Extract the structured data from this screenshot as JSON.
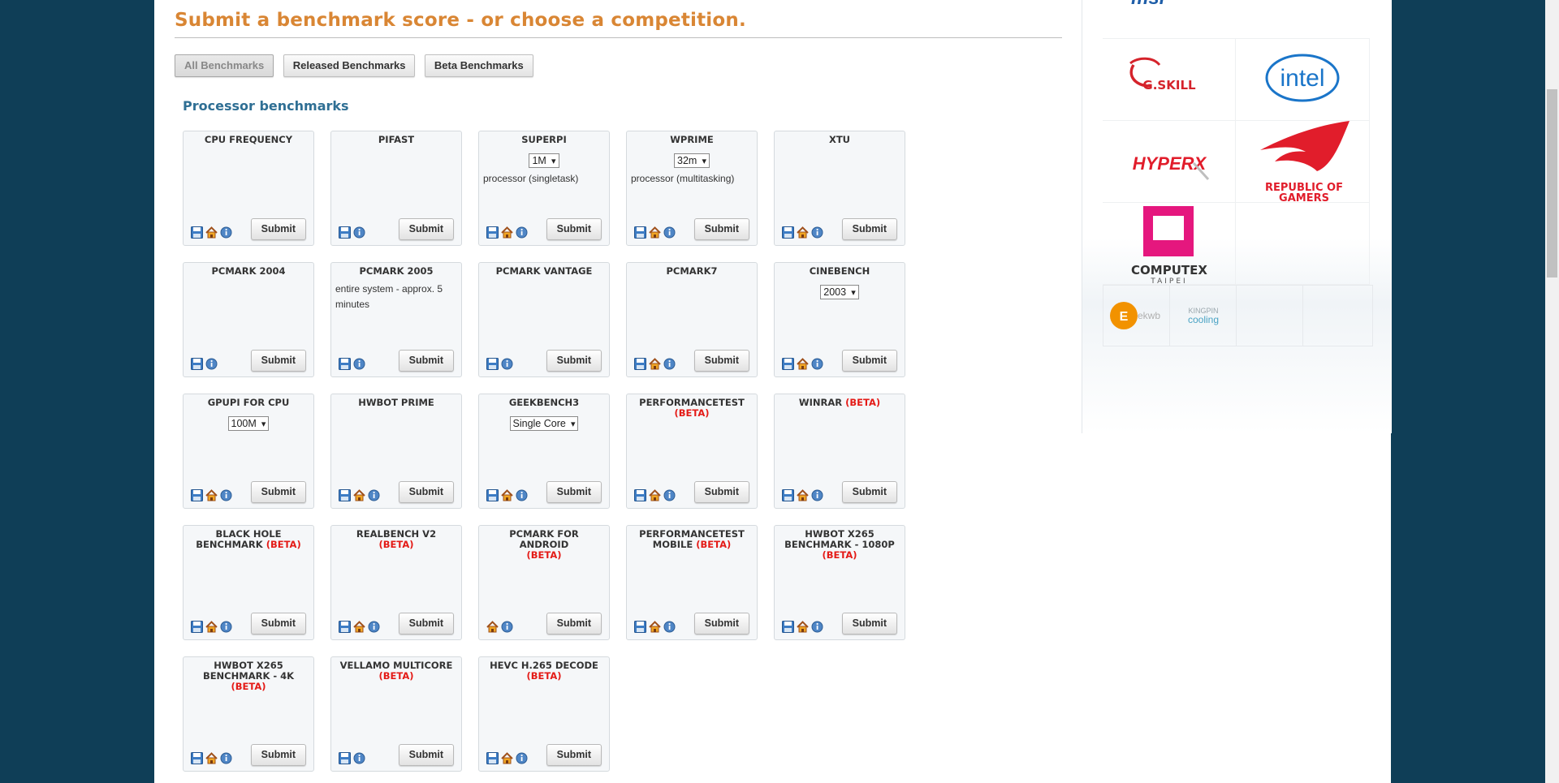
{
  "page": {
    "title": "Submit a benchmark score - or choose a competition."
  },
  "filters": [
    {
      "label": "All Benchmarks",
      "active": true
    },
    {
      "label": "Released Benchmarks",
      "active": false
    },
    {
      "label": "Beta Benchmarks",
      "active": false
    }
  ],
  "section": {
    "title": "Processor benchmarks"
  },
  "submit_label": "Submit",
  "beta_label": "(BETA)",
  "cards": [
    {
      "title": "CPU FREQUENCY",
      "icons": [
        "floppy-icon",
        "home-icon",
        "info-icon"
      ]
    },
    {
      "title": "PIFAST",
      "icons": [
        "floppy-icon",
        "info-icon"
      ]
    },
    {
      "title": "SUPERPI",
      "select": "1M",
      "desc": "processor (singletask)",
      "icons": [
        "floppy-icon",
        "home-icon",
        "info-icon"
      ]
    },
    {
      "title": "WPRIME",
      "select": "32m",
      "desc": "processor (multitasking)",
      "icons": [
        "floppy-icon",
        "home-icon",
        "info-icon"
      ]
    },
    {
      "title": "XTU",
      "icons": [
        "floppy-icon",
        "home-icon",
        "info-icon"
      ]
    },
    {
      "title": "PCMARK 2004",
      "icons": [
        "floppy-icon",
        "info-icon"
      ]
    },
    {
      "title": "PCMARK 2005",
      "desc": "entire system - approx. 5 minutes",
      "icons": [
        "floppy-icon",
        "info-icon"
      ]
    },
    {
      "title": "PCMARK VANTAGE",
      "icons": [
        "floppy-icon",
        "info-icon"
      ]
    },
    {
      "title": "PCMARK7",
      "icons": [
        "floppy-icon",
        "home-icon",
        "info-icon"
      ]
    },
    {
      "title": "CINEBENCH",
      "select": "2003",
      "icons": [
        "floppy-icon",
        "home-icon",
        "info-icon"
      ]
    },
    {
      "title": "GPUPI FOR CPU",
      "select": "100M",
      "icons": [
        "floppy-icon",
        "home-icon",
        "info-icon"
      ]
    },
    {
      "title": "HWBOT PRIME",
      "icons": [
        "floppy-icon",
        "home-icon",
        "info-icon"
      ]
    },
    {
      "title": "GEEKBENCH3",
      "select": "Single Core",
      "icons": [
        "floppy-icon",
        "home-icon",
        "info-icon"
      ]
    },
    {
      "title": "PERFORMANCETEST",
      "beta": true,
      "icons": [
        "floppy-icon",
        "home-icon",
        "info-icon"
      ]
    },
    {
      "title": "WINRAR",
      "beta": true,
      "inline_beta": true,
      "icons": [
        "floppy-icon",
        "home-icon",
        "info-icon"
      ]
    },
    {
      "title": "BLACK HOLE BENCHMARK",
      "beta": true,
      "inline_beta": true,
      "icons": [
        "floppy-icon",
        "home-icon",
        "info-icon"
      ]
    },
    {
      "title": "REALBENCH V2",
      "beta": true,
      "inline_beta": true,
      "icons": [
        "floppy-icon",
        "home-icon",
        "info-icon"
      ]
    },
    {
      "title": "PCMARK FOR ANDROID",
      "beta": true,
      "icons": [
        "home-icon",
        "info-icon"
      ]
    },
    {
      "title": "PERFORMANCETEST MOBILE",
      "beta": true,
      "inline_beta": true,
      "icons": [
        "floppy-icon",
        "home-icon",
        "info-icon"
      ]
    },
    {
      "title": "HWBOT X265 BENCHMARK - 1080P",
      "beta": true,
      "icons": [
        "floppy-icon",
        "home-icon",
        "info-icon"
      ]
    },
    {
      "title": "HWBOT X265 BENCHMARK - 4K",
      "beta": true,
      "inline_beta": true,
      "icons": [
        "floppy-icon",
        "home-icon",
        "info-icon"
      ]
    },
    {
      "title": "VELLAMO MULTICORE",
      "beta": true,
      "icons": [
        "floppy-icon",
        "info-icon"
      ]
    },
    {
      "title": "HEVC H.265 DECODE",
      "beta": true,
      "icons": [
        "floppy-icon",
        "home-icon",
        "info-icon"
      ]
    }
  ],
  "sponsors": {
    "msi": "msi",
    "gskill": "G.SKILL",
    "intel": "intel",
    "hyperx": "HYPERX",
    "rog_line1": "REPUBLIC OF",
    "rog_line2": "GAMERS",
    "computex": "COMPUTEX",
    "computex_sub": "TAIPEI",
    "ekwb": "ekwb",
    "kingpin_line1": "KINGPIN",
    "kingpin_line2": "cooling"
  },
  "colors": {
    "accent_title": "#d98634",
    "section_title": "#2f6f94",
    "beta": "#e41b17",
    "background": "#0f3e57"
  }
}
